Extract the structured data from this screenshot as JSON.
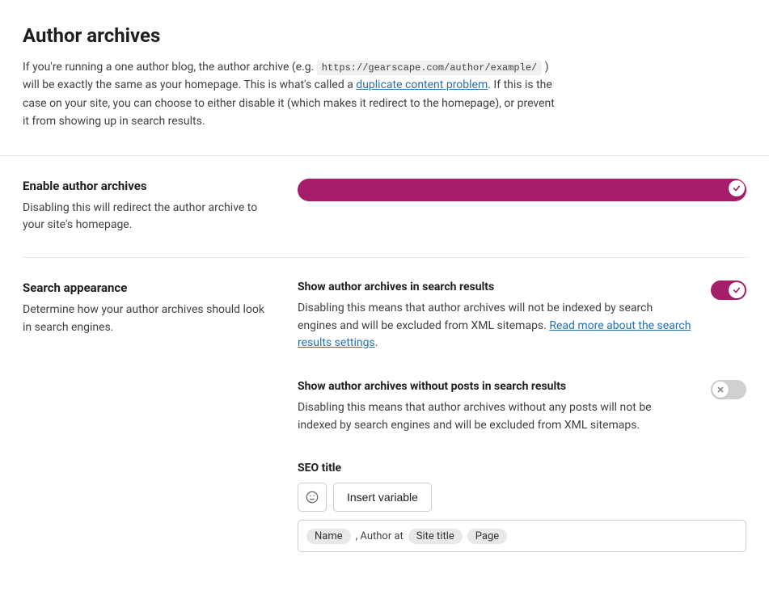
{
  "page": {
    "title": "Author archives",
    "intro_before": "If you're running a one author blog, the author archive (e.g. ",
    "intro_code": "https://gearscape.com/author/example/",
    "intro_mid": " ) will be exactly the same as your homepage. This is what's called a ",
    "intro_link": "duplicate content problem",
    "intro_after": ". If this is the case on your site, you can choose to either disable it (which makes it redirect to the homepage), or prevent it from showing up in search results."
  },
  "enable_archives": {
    "heading": "Enable author archives",
    "desc": "Disabling this will redirect the author archive to your site's homepage.",
    "state": "on"
  },
  "search_appearance": {
    "heading": "Search appearance",
    "desc": "Determine how your author archives should look in search engines."
  },
  "show_in_results": {
    "title": "Show author archives in search results",
    "desc_before": "Disabling this means that author archives will not be indexed by search engines and will be excluded from XML sitemaps. ",
    "link": "Read more about the search results settings",
    "desc_after": ".",
    "state": "on"
  },
  "show_no_posts": {
    "title": "Show author archives without posts in search results",
    "desc": "Disabling this means that author archives without any posts will not be indexed by search engines and will be excluded from XML sitemaps.",
    "state": "off"
  },
  "seo_title": {
    "label": "SEO title",
    "insert_variable": "Insert variable",
    "chips": {
      "name": "Name",
      "site_title": "Site title",
      "page": "Page"
    },
    "sep": ", Author at"
  }
}
